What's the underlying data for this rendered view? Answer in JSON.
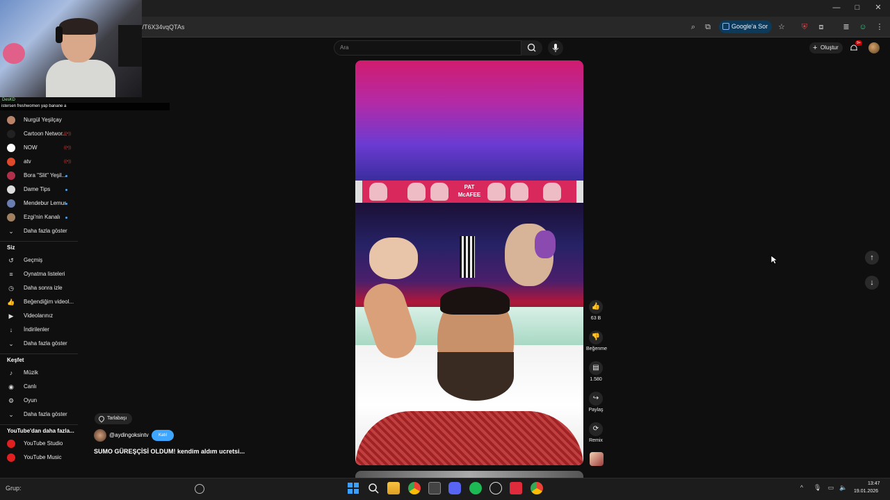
{
  "browser": {
    "url_fragment": "s/T6X34vqQTAs",
    "google_sor": "Google'a Sor",
    "window_controls": [
      "—",
      "□",
      "✕"
    ]
  },
  "webcam": {
    "streamer_tag": "DesKD",
    "chat_message": "istersen freshwomen yap banane a"
  },
  "topbar": {
    "search_placeholder": "Ara",
    "create_label": "Oluştur",
    "notif_count": "9+"
  },
  "sidebar": {
    "subscriptions": [
      {
        "label": "Nurgül Yeşilçay",
        "badge": "",
        "color": "#b9836a"
      },
      {
        "label": "Cartoon Networ...",
        "badge": "live",
        "color": "#222222"
      },
      {
        "label": "NOW",
        "badge": "live",
        "color": "#ffffff"
      },
      {
        "label": "atv",
        "badge": "live",
        "color": "#e04a2a"
      },
      {
        "label": "Bora \"Slit\" Yeşil...",
        "badge": "dot",
        "color": "#b0304a"
      },
      {
        "label": "Dame Tips",
        "badge": "dot",
        "color": "#dddddd"
      },
      {
        "label": "Mendebur Lemur",
        "badge": "dot",
        "color": "#6a7db0"
      },
      {
        "label": "Ezgi'nin Kanalı",
        "badge": "dot",
        "color": "#a08060"
      },
      {
        "label": "Daha fazla göster",
        "badge": "",
        "color": ""
      }
    ],
    "you_header": "Siz",
    "you_items": [
      {
        "label": "Geçmiş",
        "icon": "history-icon",
        "glyph": "↺"
      },
      {
        "label": "Oynatma listeleri",
        "icon": "playlist-icon",
        "glyph": "≡"
      },
      {
        "label": "Daha sonra izle",
        "icon": "clock-icon",
        "glyph": "◷"
      },
      {
        "label": "Beğendiğim videol...",
        "icon": "like-icon",
        "glyph": "👍"
      },
      {
        "label": "Videolarınız",
        "icon": "video-icon",
        "glyph": "▶"
      },
      {
        "label": "İndirilenler",
        "icon": "download-icon",
        "glyph": "↓"
      },
      {
        "label": "Daha fazla göster",
        "icon": "chevron-down-icon",
        "glyph": "⌄"
      }
    ],
    "explore_header": "Keşfet",
    "explore_items": [
      {
        "label": "Müzik",
        "icon": "music-icon",
        "glyph": "♪"
      },
      {
        "label": "Canlı",
        "icon": "live-icon",
        "glyph": "◉"
      },
      {
        "label": "Oyun",
        "icon": "gaming-icon",
        "glyph": "⚙"
      },
      {
        "label": "Daha fazla göster",
        "icon": "chevron-down-icon",
        "glyph": "⌄"
      }
    ],
    "more_header": "YouTube'dan daha fazla...",
    "more_items": [
      {
        "label": "YouTube Studio"
      },
      {
        "label": "YouTube Music"
      }
    ]
  },
  "short": {
    "location": "Tarlabaşı",
    "channel": "@aydingoksintv",
    "subscribe": "Katıl",
    "title": "SUMO GÜREŞÇİSİ OLDUM! kendim aldım ucretsi...",
    "banner_text": "PAT McAFEE"
  },
  "actions": {
    "likes": "63 B",
    "dislike": "Beğenme",
    "comments": "1.580",
    "share": "Paylaş",
    "remix": "Remix"
  },
  "taskbar": {
    "search_label": "Grup:",
    "time": "13:47",
    "date": "19.01.2026"
  }
}
